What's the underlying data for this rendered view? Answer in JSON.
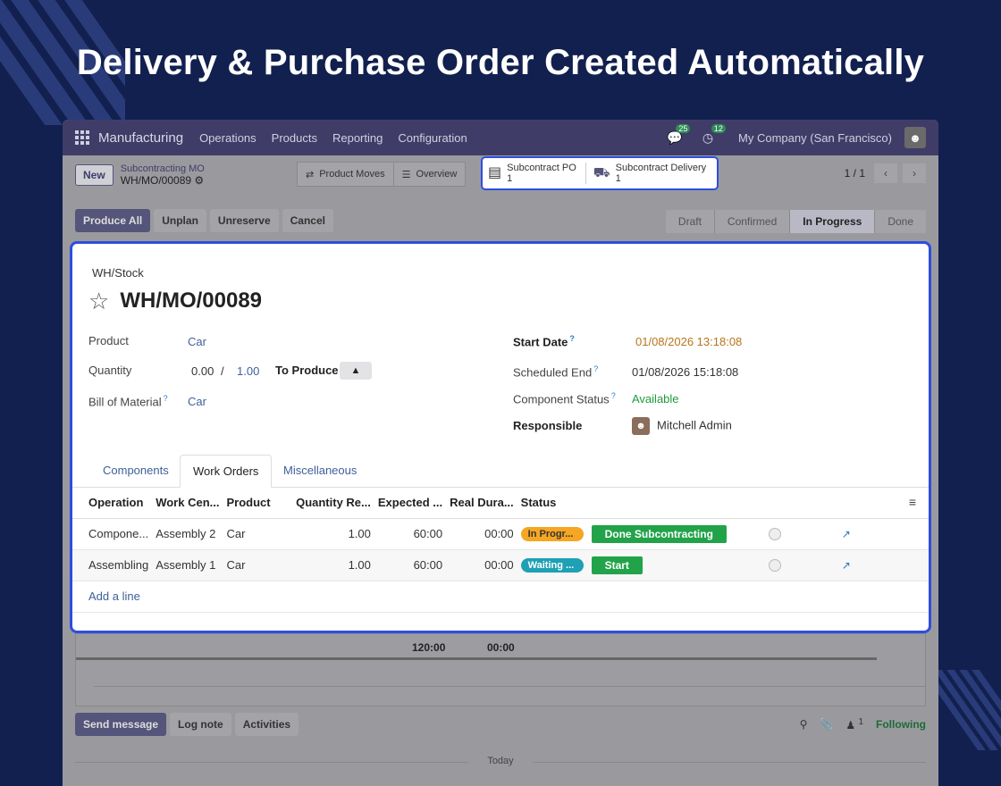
{
  "headline": "Delivery & Purchase Order Created Automatically",
  "navbar": {
    "app_name": "Manufacturing",
    "menu": [
      "Operations",
      "Products",
      "Reporting",
      "Configuration"
    ],
    "chat_count": "25",
    "activity_count": "12",
    "company": "My Company (San Francisco)"
  },
  "control": {
    "new_label": "New",
    "breadcrumb_parent": "Subcontracting MO",
    "breadcrumb_current": "WH/MO/00089",
    "product_moves_label": "Product Moves",
    "overview_label": "Overview",
    "subcontract_po_label": "Subcontract PO",
    "subcontract_po_count": "1",
    "subcontract_delivery_label": "Subcontract Delivery",
    "subcontract_delivery_count": "1",
    "pager": "1 / 1"
  },
  "actions": {
    "produce_all": "Produce All",
    "unplan": "Unplan",
    "unreserve": "Unreserve",
    "cancel": "Cancel",
    "stages": [
      "Draft",
      "Confirmed",
      "In Progress",
      "Done"
    ],
    "active_stage": "In Progress"
  },
  "form": {
    "location": "WH/Stock",
    "title": "WH/MO/00089",
    "product_label": "Product",
    "product_value": "Car",
    "quantity_label": "Quantity",
    "quantity_done": "0.00",
    "quantity_sep": "/",
    "quantity_total": "1.00",
    "to_produce_label": "To Produce",
    "bom_label": "Bill of Material",
    "bom_value": "Car",
    "start_date_label": "Start Date",
    "start_date_value": "01/08/2026 13:18:08",
    "scheduled_end_label": "Scheduled End",
    "scheduled_end_value": "01/08/2026 15:18:08",
    "component_status_label": "Component Status",
    "component_status_value": "Available",
    "responsible_label": "Responsible",
    "responsible_value": "Mitchell Admin",
    "help_mark": "?"
  },
  "tabs": [
    "Components",
    "Work Orders",
    "Miscellaneous"
  ],
  "work_orders": {
    "columns": [
      "Operation",
      "Work Cen...",
      "Product",
      "Quantity Re...",
      "Expected ...",
      "Real Dura...",
      "Status"
    ],
    "rows": [
      {
        "operation": "Compone...",
        "work_center": "Assembly 2",
        "product": "Car",
        "qty": "1.00",
        "expected": "60:00",
        "real": "00:00",
        "status": "In Progr...",
        "action": "Done Subcontracting"
      },
      {
        "operation": "Assembling",
        "work_center": "Assembly 1",
        "product": "Car",
        "qty": "1.00",
        "expected": "60:00",
        "real": "00:00",
        "status": "Waiting ...",
        "action": "Start"
      }
    ],
    "add_line": "Add a line",
    "total_expected": "120:00",
    "total_real": "00:00"
  },
  "chatter": {
    "send_message": "Send message",
    "log_note": "Log note",
    "activities": "Activities",
    "followers_count": "1",
    "following": "Following",
    "today": "Today"
  }
}
